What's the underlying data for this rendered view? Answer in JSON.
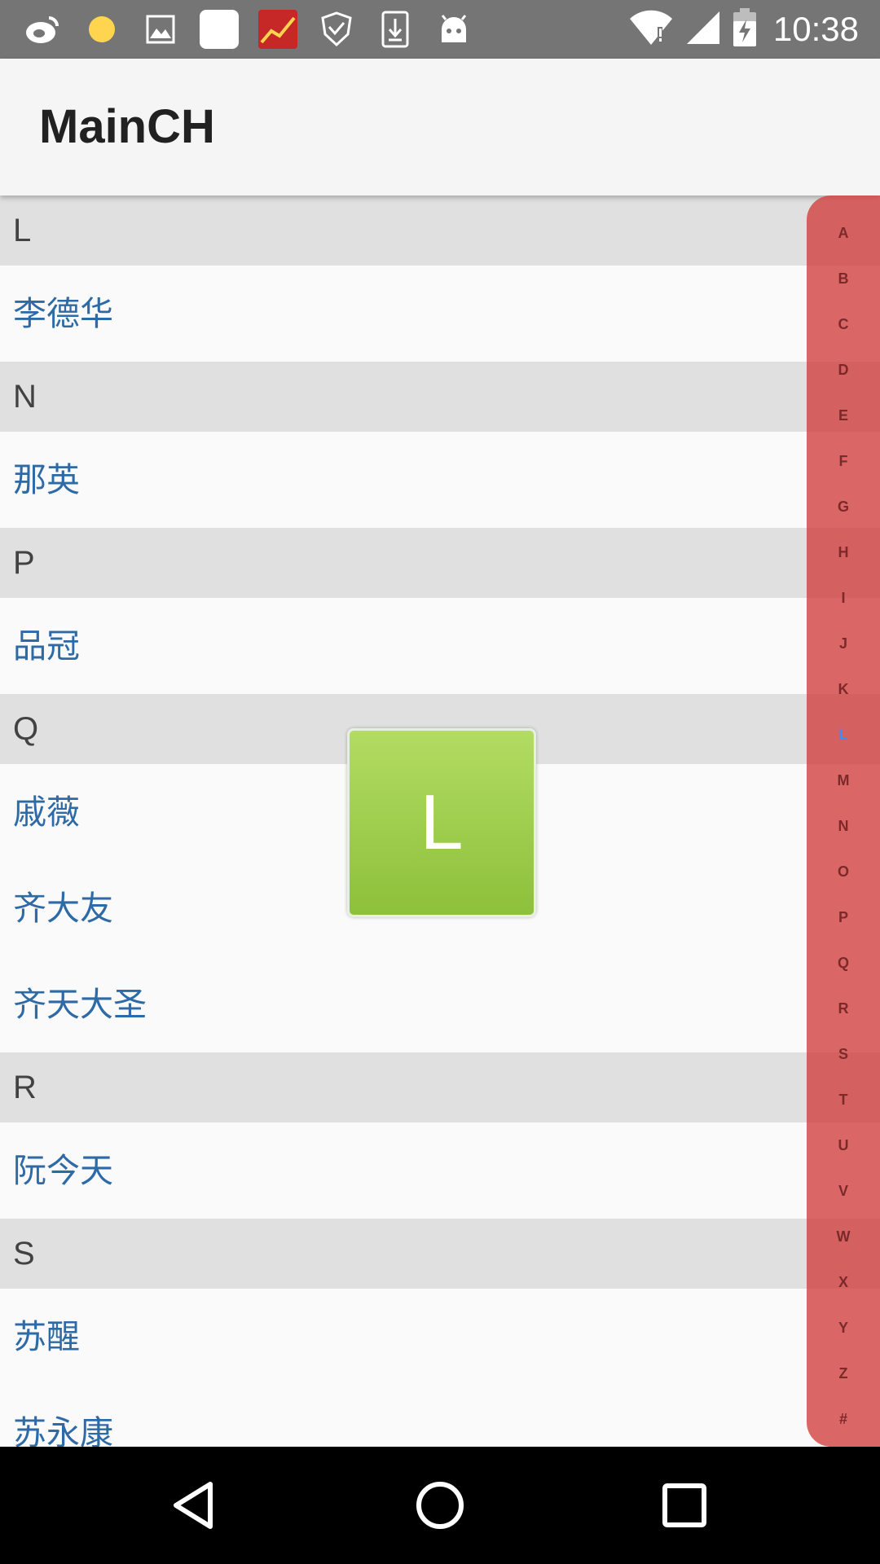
{
  "status_bar": {
    "time": "10:38",
    "left_icons": [
      "weibo-icon",
      "notification-dot-icon",
      "gallery-icon",
      "blank-app-icon",
      "news-app-icon",
      "shield-icon",
      "download-icon",
      "android-icon"
    ],
    "right_icons": [
      "wifi-icon",
      "signal-icon",
      "battery-charging-icon"
    ]
  },
  "app_bar": {
    "title": "MainCH"
  },
  "contact_list": {
    "sections": [
      {
        "letter": "L",
        "names": [
          "李德华"
        ]
      },
      {
        "letter": "N",
        "names": [
          "那英"
        ]
      },
      {
        "letter": "P",
        "names": [
          "品冠"
        ]
      },
      {
        "letter": "Q",
        "names": [
          "戚薇",
          "齐大友",
          "齐天大圣"
        ]
      },
      {
        "letter": "R",
        "names": [
          "阮今天"
        ]
      },
      {
        "letter": "S",
        "names": [
          "苏醒",
          "苏永康"
        ]
      }
    ]
  },
  "index_bar": {
    "letters": [
      "A",
      "B",
      "C",
      "D",
      "E",
      "F",
      "G",
      "H",
      "I",
      "J",
      "K",
      "L",
      "M",
      "N",
      "O",
      "P",
      "Q",
      "R",
      "S",
      "T",
      "U",
      "V",
      "W",
      "X",
      "Y",
      "Z",
      "#"
    ],
    "selected": "L",
    "colors": {
      "bar": "#d23c3c",
      "selected_letter": "#3d8bff"
    }
  },
  "letter_overlay": {
    "letter": "L",
    "color": "#8dc03b"
  },
  "nav_bar": {
    "buttons": [
      "back-icon",
      "home-icon",
      "recents-icon"
    ]
  }
}
